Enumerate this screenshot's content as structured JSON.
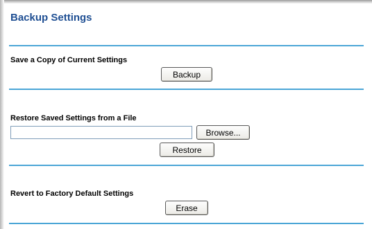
{
  "page": {
    "title": "Backup Settings"
  },
  "backup": {
    "label": "Save a Copy of Current Settings",
    "button_label": "Backup"
  },
  "restore": {
    "label": "Restore Saved Settings from a File",
    "file_value": "",
    "browse_label": "Browse...",
    "button_label": "Restore"
  },
  "factory": {
    "label": "Revert to Factory Default Settings",
    "button_label": "Erase"
  },
  "colors": {
    "title": "#1f4f93",
    "divider": "#4aa5d6"
  }
}
